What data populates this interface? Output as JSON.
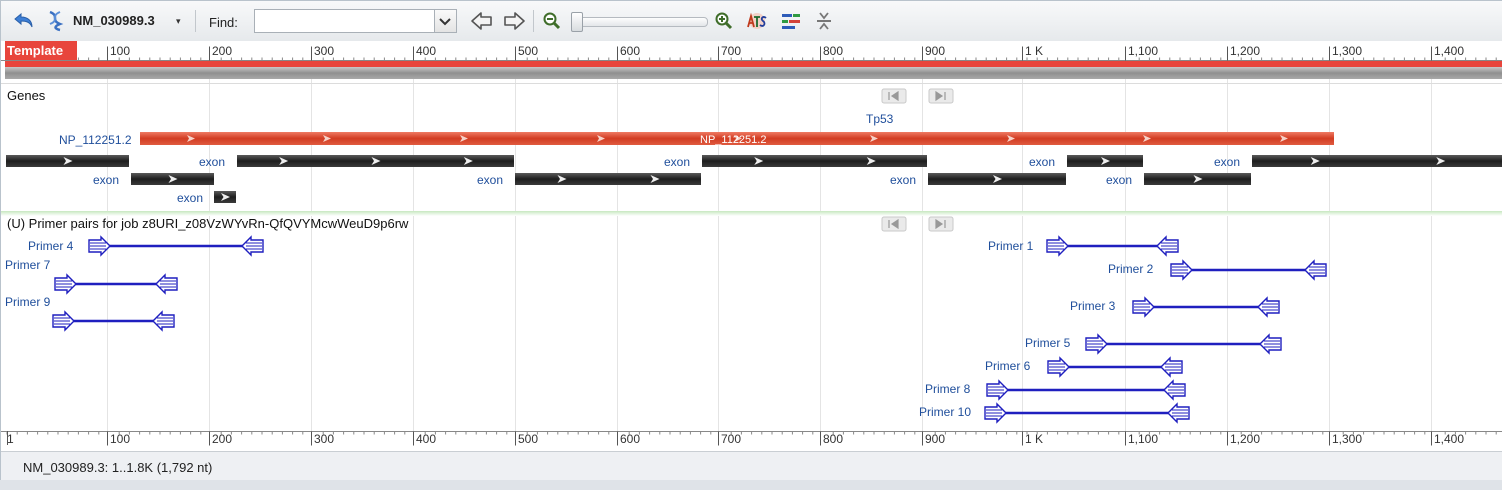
{
  "toolbar": {
    "accession": "NM_030989.3",
    "accession_caret": "▾",
    "find_label": "Find:",
    "find_value": ""
  },
  "ruler": {
    "template_label": "Template",
    "ticks": [
      "100",
      "200",
      "300",
      "400",
      "500",
      "600",
      "700",
      "800",
      "900",
      "1 K",
      "1,100",
      "1,200",
      "1,300",
      "1,400"
    ],
    "bottom_start": "1"
  },
  "genes_track": {
    "title": "Genes",
    "gene_label_left": "NP_112251.2",
    "gene_label_center": "NP_112251.2",
    "gene_name": "Tp53",
    "exon_label": "exon"
  },
  "primer_track": {
    "title": "(U) Primer pairs for job z8URI_z08VzWYvRn-QfQVYMcwWeuD9p6rw",
    "primers": [
      {
        "label": "Primer 4"
      },
      {
        "label": "Primer 7"
      },
      {
        "label": "Primer 9"
      },
      {
        "label": "Primer 1"
      },
      {
        "label": "Primer 2"
      },
      {
        "label": "Primer 3"
      },
      {
        "label": "Primer 5"
      },
      {
        "label": "Primer 6"
      },
      {
        "label": "Primer 8"
      },
      {
        "label": "Primer 10"
      }
    ]
  },
  "status": {
    "text": "NM_030989.3: 1..1.8K (1,792 nt)"
  },
  "colors": {
    "gene_red": "#d9442c",
    "exon_dark": "#2b2b2b",
    "primer_blue": "#1f1fbf",
    "template_red": "#e8453c",
    "label_blue": "#1f4e9b"
  }
}
